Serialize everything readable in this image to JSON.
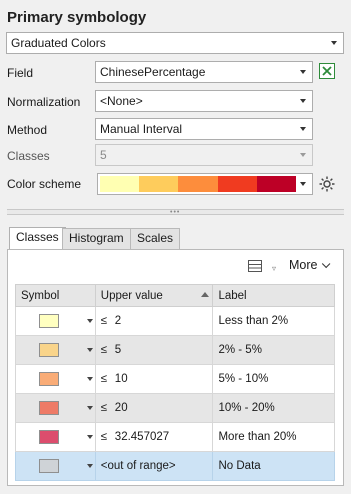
{
  "section": {
    "title": "Primary symbology"
  },
  "renderer": {
    "value": "Graduated Colors"
  },
  "fields": {
    "field_label": "Field",
    "field_value": "ChinesePercentage",
    "normalization_label": "Normalization",
    "normalization_value": "<None>",
    "method_label": "Method",
    "method_value": "Manual Interval",
    "classes_label": "Classes",
    "classes_value": "5",
    "color_scheme_label": "Color scheme"
  },
  "color_scheme": {
    "colors": [
      "#ffffb2",
      "#fecc5c",
      "#fd8d3c",
      "#f03b20",
      "#bd0026"
    ]
  },
  "tabs": [
    {
      "label": "Classes",
      "active": true
    },
    {
      "label": "Histogram",
      "active": false
    },
    {
      "label": "Scales",
      "active": false
    }
  ],
  "toolbar": {
    "more_label": "More"
  },
  "table": {
    "headers": {
      "symbol": "Symbol",
      "upper": "Upper value",
      "label": "Label"
    },
    "rows": [
      {
        "color": "#ffffc0",
        "op": "≤",
        "upper": "2",
        "label": "Less than 2%"
      },
      {
        "color": "#f9d48a",
        "op": "≤",
        "upper": "5",
        "label": "2% - 5%"
      },
      {
        "color": "#f9ac77",
        "op": "≤",
        "upper": "10",
        "label": "5% - 10%"
      },
      {
        "color": "#ee7b67",
        "op": "≤",
        "upper": "20",
        "label": "10% - 20%"
      },
      {
        "color": "#dc4d6d",
        "op": "≤",
        "upper": "32.457027",
        "label": "More than 20%"
      },
      {
        "color": "#cfd3d7",
        "op": "",
        "upper": "<out of range>",
        "label": "No Data"
      }
    ]
  }
}
